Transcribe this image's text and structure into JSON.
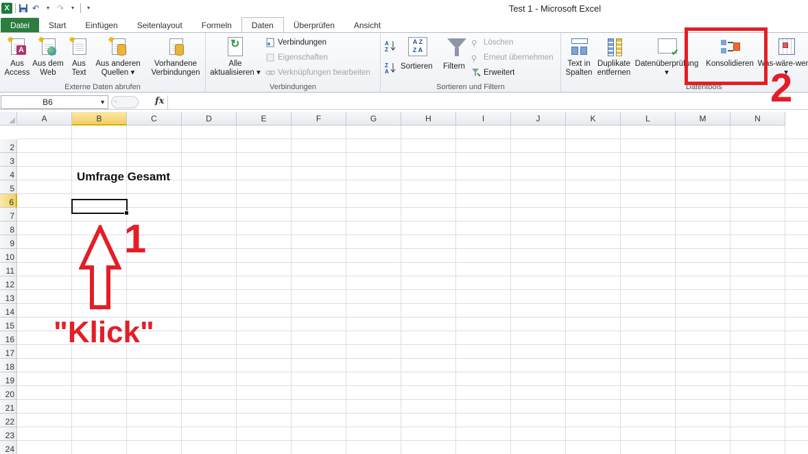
{
  "window": {
    "title": "Test 1  -  Microsoft Excel",
    "app_icon": "X"
  },
  "tabs": [
    "Datei",
    "Start",
    "Einfügen",
    "Seitenlayout",
    "Formeln",
    "Daten",
    "Überprüfen",
    "Ansicht"
  ],
  "active_tab": "Daten",
  "ribbon": {
    "externe": {
      "label": "Externe Daten abrufen",
      "access": [
        "Aus",
        "Access"
      ],
      "web": [
        "Aus dem",
        "Web"
      ],
      "text": [
        "Aus",
        "Text"
      ],
      "andere": [
        "Aus anderen",
        "Quellen ▾"
      ],
      "vorhandene": [
        "Vorhandene",
        "Verbindungen"
      ]
    },
    "verbindungen": {
      "label": "Verbindungen",
      "alle": [
        "Alle",
        "aktualisieren ▾"
      ],
      "verbindungen": "Verbindungen",
      "eigenschaften": "Eigenschaften",
      "verknuepfungen": "Verknüpfungen bearbeiten"
    },
    "sortieren": {
      "label": "Sortieren und Filtern",
      "sortieren": "Sortieren",
      "filtern": "Filtern",
      "loeschen": "Löschen",
      "erneut": "Erneut übernehmen",
      "erweitert": "Erweitert"
    },
    "datentools": {
      "label": "Datentools",
      "text_in_spalten": [
        "Text in",
        "Spalten"
      ],
      "duplikate": [
        "Duplikate",
        "entfernen"
      ],
      "datenueberpruefung": [
        "Datenüberprüfung",
        "▾"
      ],
      "konsolidieren": "Konsolidieren",
      "was_waere": [
        "Was-wäre-wenn",
        "▾"
      ]
    }
  },
  "formula_bar": {
    "name_box": "B6",
    "fx": "fx",
    "formula": ""
  },
  "columns": [
    "A",
    "B",
    "C",
    "D",
    "E",
    "F",
    "G",
    "H",
    "I",
    "J",
    "K",
    "L",
    "M",
    "N"
  ],
  "rows": [
    "2",
    "3",
    "4",
    "5",
    "6",
    "7",
    "8",
    "9",
    "10",
    "11",
    "12",
    "13",
    "14",
    "15",
    "16",
    "17",
    "18",
    "19",
    "20",
    "21",
    "22",
    "23",
    "24"
  ],
  "selected_column": "B",
  "selected_row": "6",
  "cells": {
    "B4": "Umfrage Gesamt"
  },
  "annotations": {
    "step1": "1",
    "step2": "2",
    "click_label": "\"Klick\"",
    "color": "#e41e26"
  }
}
